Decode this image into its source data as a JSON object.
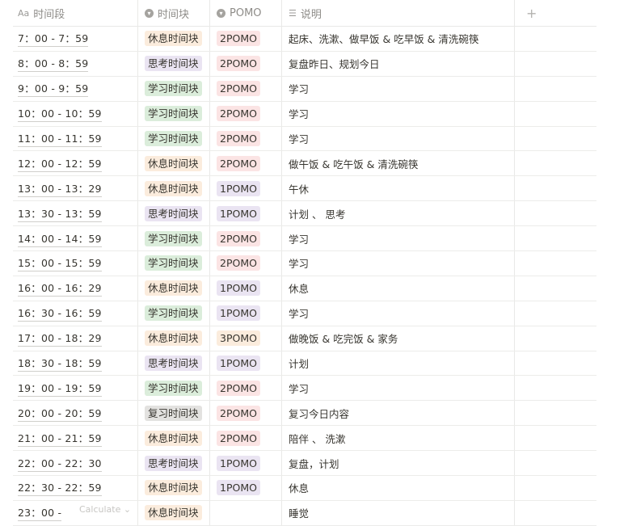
{
  "header": {
    "col1_label": "时间段",
    "col1_icon": "Aa",
    "col2_label": "时间块",
    "col3_label": "POMO",
    "col4_label": "说明",
    "add_label": "+"
  },
  "rows": [
    {
      "time": "7：00 - 7：59",
      "block": "休息时间块",
      "block_type": "rest",
      "pomo": "2POMO",
      "pomo_type": "2",
      "note": "起床、洗漱、做早饭 & 吃早饭 & 清洗碗筷"
    },
    {
      "time": "8：00 - 8：59",
      "block": "思考时间块",
      "block_type": "think",
      "pomo": "2POMO",
      "pomo_type": "2",
      "note": "复盘昨日、规划今日"
    },
    {
      "time": "9：00 - 9：59",
      "block": "学习时间块",
      "block_type": "study",
      "pomo": "2POMO",
      "pomo_type": "2",
      "note": "学习"
    },
    {
      "time": "10：00 - 10：59",
      "block": "学习时间块",
      "block_type": "study",
      "pomo": "2POMO",
      "pomo_type": "2",
      "note": "学习"
    },
    {
      "time": "11：00 - 11：59",
      "block": "学习时间块",
      "block_type": "study",
      "pomo": "2POMO",
      "pomo_type": "2",
      "note": "学习"
    },
    {
      "time": "12：00 - 12：59",
      "block": "休息时间块",
      "block_type": "rest",
      "pomo": "2POMO",
      "pomo_type": "2",
      "note": "做午饭 & 吃午饭 & 清洗碗筷"
    },
    {
      "time": "13：00 - 13：29",
      "block": "休息时间块",
      "block_type": "rest",
      "pomo": "1POMO",
      "pomo_type": "1",
      "note": "午休"
    },
    {
      "time": "13：30 - 13：59",
      "block": "思考时间块",
      "block_type": "think",
      "pomo": "1POMO",
      "pomo_type": "1",
      "note": "计划 、 思考"
    },
    {
      "time": "14：00 - 14：59",
      "block": "学习时间块",
      "block_type": "study",
      "pomo": "2POMO",
      "pomo_type": "2",
      "note": "学习"
    },
    {
      "time": "15：00 - 15：59",
      "block": "学习时间块",
      "block_type": "study",
      "pomo": "2POMO",
      "pomo_type": "2",
      "note": "学习"
    },
    {
      "time": "16：00 - 16：29",
      "block": "休息时间块",
      "block_type": "rest",
      "pomo": "1POMO",
      "pomo_type": "1",
      "note": "休息"
    },
    {
      "time": "16：30 - 16：59",
      "block": "学习时间块",
      "block_type": "study",
      "pomo": "1POMO",
      "pomo_type": "1",
      "note": "学习"
    },
    {
      "time": "17：00 - 18：29",
      "block": "休息时间块",
      "block_type": "rest",
      "pomo": "3POMO",
      "pomo_type": "3",
      "note": "做晚饭 & 吃完饭 & 家务"
    },
    {
      "time": "18：30 - 18：59",
      "block": "思考时间块",
      "block_type": "think",
      "pomo": "1POMO",
      "pomo_type": "1",
      "note": "计划"
    },
    {
      "time": "19：00 - 19：59",
      "block": "学习时间块",
      "block_type": "study",
      "pomo": "2POMO",
      "pomo_type": "2",
      "note": "学习"
    },
    {
      "time": "20：00 - 20：59",
      "block": "复习时间块",
      "block_type": "review",
      "pomo": "2POMO",
      "pomo_type": "2",
      "note": "复习今日内容"
    },
    {
      "time": "21：00 - 21：59",
      "block": "休息时间块",
      "block_type": "rest",
      "pomo": "2POMO",
      "pomo_type": "2",
      "note": "陪伴 、 洗漱"
    },
    {
      "time": "22：00 - 22：30",
      "block": "思考时间块",
      "block_type": "think",
      "pomo": "1POMO",
      "pomo_type": "1",
      "note": "复盘，计划"
    },
    {
      "time": "22：30 - 22：59",
      "block": "休息时间块",
      "block_type": "rest",
      "pomo": "1POMO",
      "pomo_type": "1",
      "note": "休息"
    },
    {
      "time": "23：00 -",
      "block": "休息时间块",
      "block_type": "rest",
      "pomo": "",
      "pomo_type": "",
      "note": "睡觉"
    }
  ],
  "footer": {
    "calculate_label": "Calculate ⌄"
  }
}
